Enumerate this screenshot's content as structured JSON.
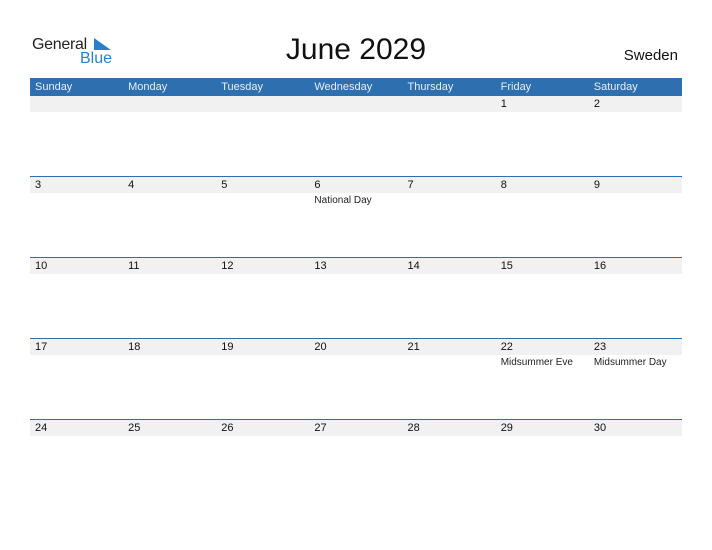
{
  "logo": {
    "general": "General",
    "blue": "Blue"
  },
  "title": "June 2029",
  "country": "Sweden",
  "weekdays": [
    "Sunday",
    "Monday",
    "Tuesday",
    "Wednesday",
    "Thursday",
    "Friday",
    "Saturday"
  ],
  "weeks": [
    [
      {
        "day": ""
      },
      {
        "day": ""
      },
      {
        "day": ""
      },
      {
        "day": ""
      },
      {
        "day": ""
      },
      {
        "day": "1"
      },
      {
        "day": "2"
      }
    ],
    [
      {
        "day": "3"
      },
      {
        "day": "4"
      },
      {
        "day": "5"
      },
      {
        "day": "6",
        "holiday": "National Day"
      },
      {
        "day": "7"
      },
      {
        "day": "8"
      },
      {
        "day": "9"
      }
    ],
    [
      {
        "day": "10"
      },
      {
        "day": "11"
      },
      {
        "day": "12"
      },
      {
        "day": "13"
      },
      {
        "day": "14"
      },
      {
        "day": "15"
      },
      {
        "day": "16"
      }
    ],
    [
      {
        "day": "17"
      },
      {
        "day": "18"
      },
      {
        "day": "19"
      },
      {
        "day": "20"
      },
      {
        "day": "21"
      },
      {
        "day": "22",
        "holiday": "Midsummer Eve"
      },
      {
        "day": "23",
        "holiday": "Midsummer Day"
      }
    ],
    [
      {
        "day": "24"
      },
      {
        "day": "25"
      },
      {
        "day": "26"
      },
      {
        "day": "27"
      },
      {
        "day": "28"
      },
      {
        "day": "29"
      },
      {
        "day": "30"
      }
    ]
  ],
  "colors": {
    "header": "#2e6fb0",
    "accent": "#2a7fc9",
    "day_bar": "#f1f1f1"
  }
}
